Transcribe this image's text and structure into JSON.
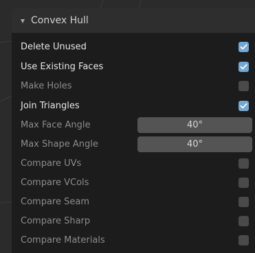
{
  "panel": {
    "title": "Convex Hull",
    "colors": {
      "background": "#1c1c1c",
      "header": "#2e2e2e",
      "checkbox_on": "#71a8d6",
      "checkbox_off": "#4a4a4a",
      "field": "#545454"
    }
  },
  "options": {
    "delete_unused": {
      "label": "Delete Unused",
      "checked": true
    },
    "use_existing_faces": {
      "label": "Use Existing Faces",
      "checked": true
    },
    "make_holes": {
      "label": "Make Holes",
      "checked": false
    },
    "join_triangles": {
      "label": "Join Triangles",
      "checked": true
    },
    "max_face_angle": {
      "label": "Max Face Angle",
      "value": "40°"
    },
    "max_shape_angle": {
      "label": "Max Shape Angle",
      "value": "40°"
    },
    "compare_uvs": {
      "label": "Compare UVs",
      "checked": false
    },
    "compare_vcols": {
      "label": "Compare VCols",
      "checked": false
    },
    "compare_seam": {
      "label": "Compare Seam",
      "checked": false
    },
    "compare_sharp": {
      "label": "Compare Sharp",
      "checked": false
    },
    "compare_materials": {
      "label": "Compare Materials",
      "checked": false
    }
  }
}
